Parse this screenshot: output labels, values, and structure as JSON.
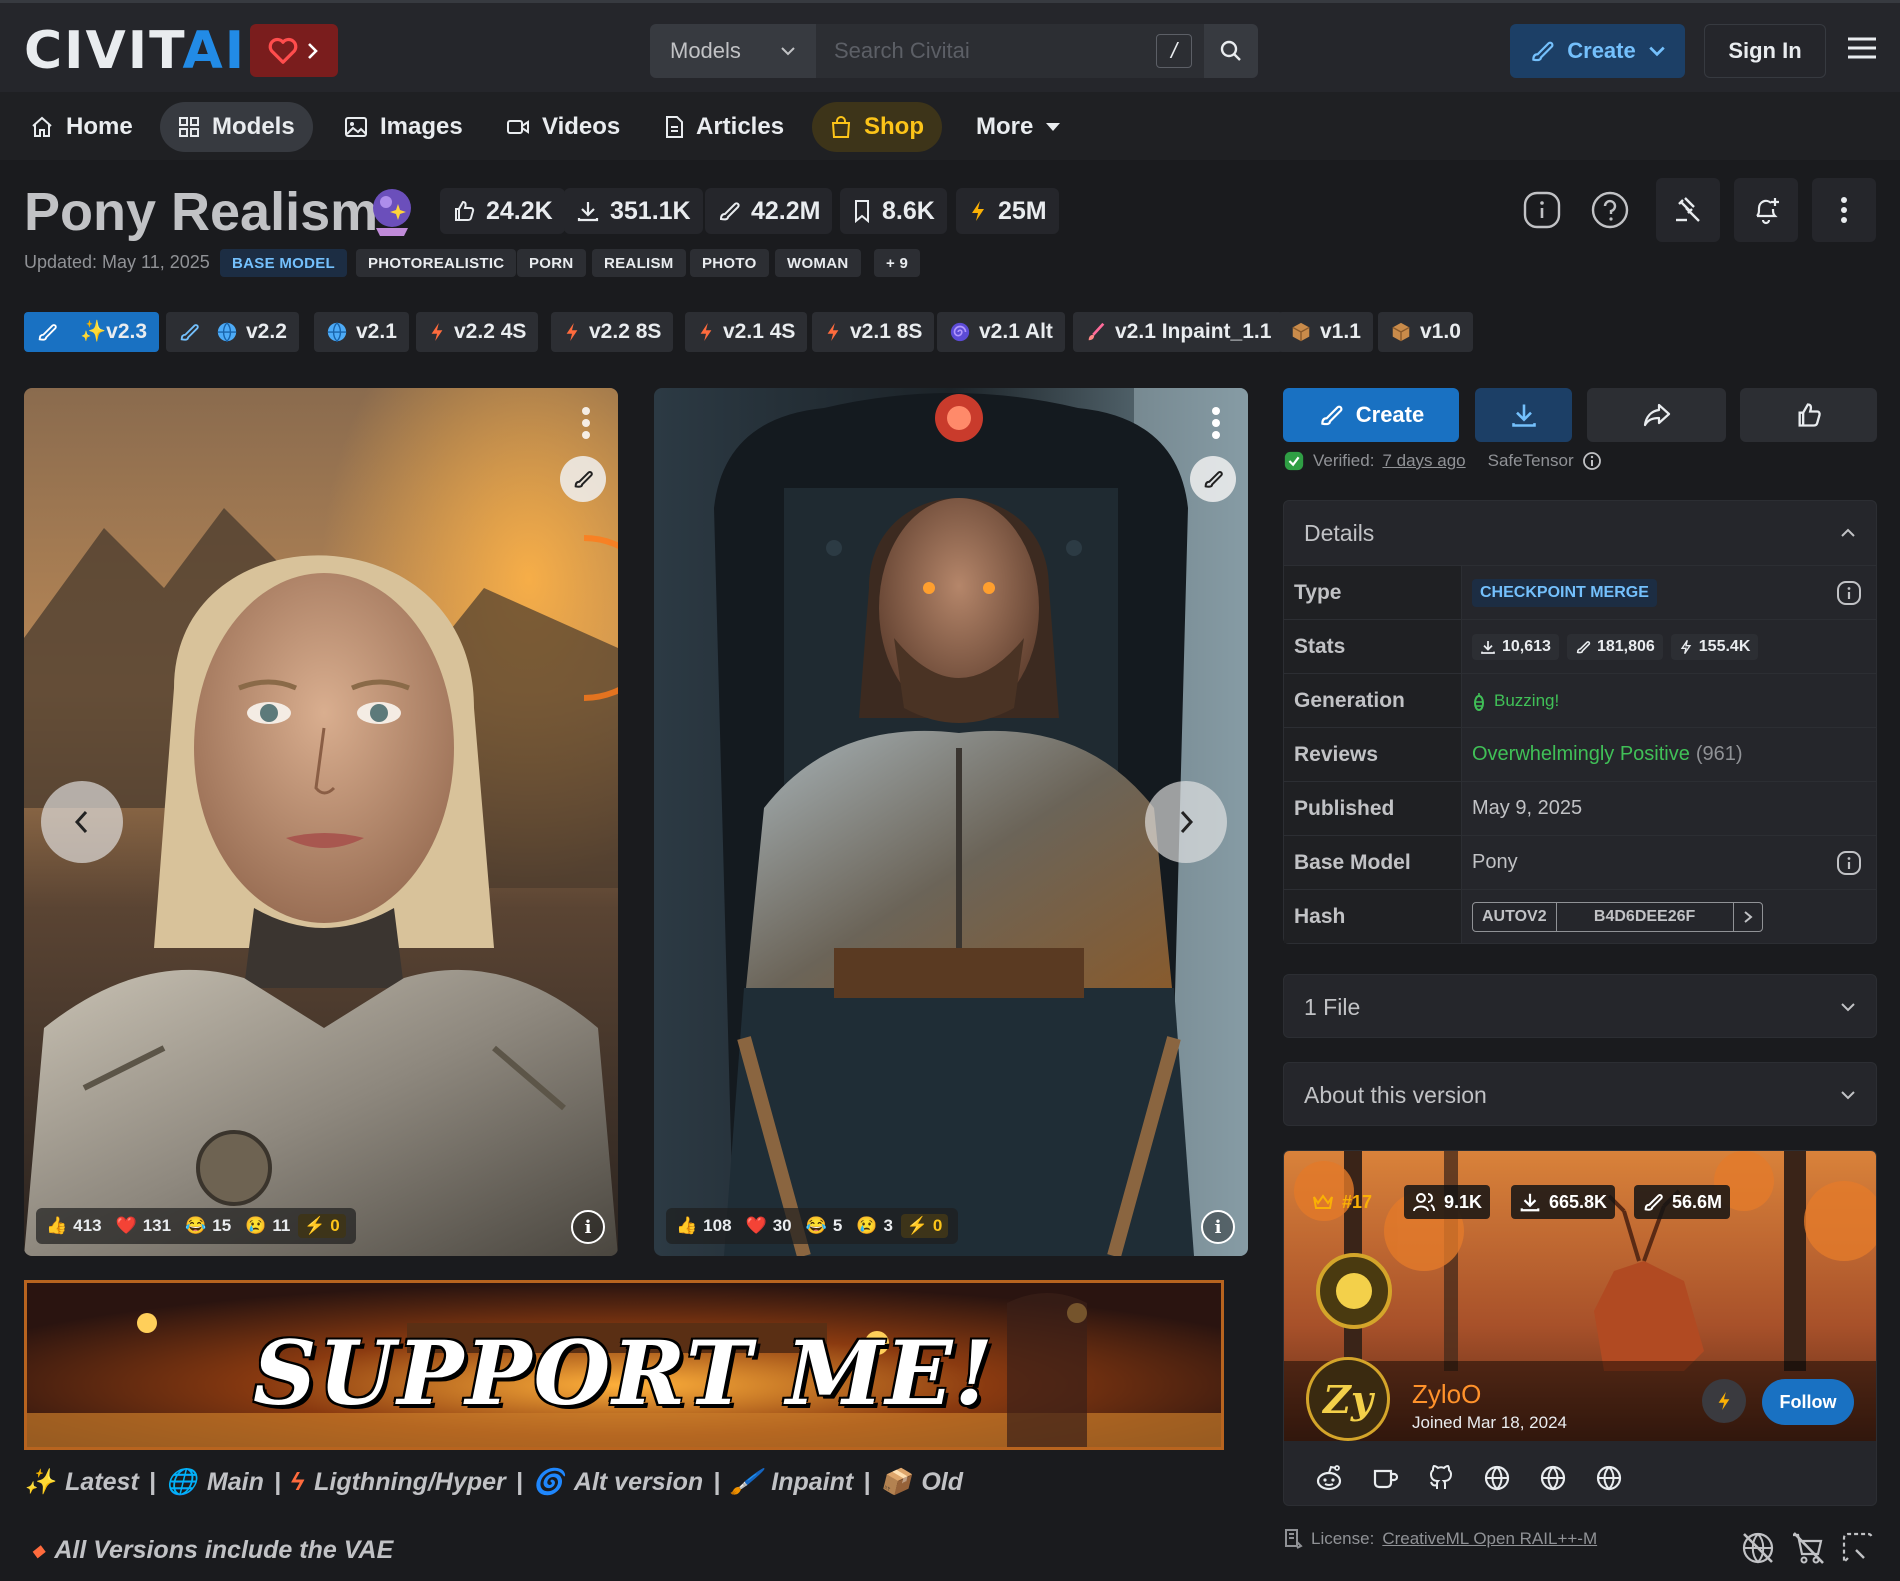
{
  "header": {
    "logo_main": "CIVIT",
    "logo_ai": "AI",
    "search_category": "Models",
    "search_placeholder": "Search Civitai",
    "search_shortcut": "/",
    "create_label": "Create",
    "signin_label": "Sign In"
  },
  "nav": [
    {
      "label": "Home",
      "icon": "home-icon"
    },
    {
      "label": "Models",
      "icon": "models-grid-icon"
    },
    {
      "label": "Images",
      "icon": "image-icon"
    },
    {
      "label": "Videos",
      "icon": "video-icon"
    },
    {
      "label": "Articles",
      "icon": "article-icon"
    },
    {
      "label": "Shop",
      "icon": "shopping-bag-icon"
    },
    {
      "label": "More",
      "icon": "caret-down-icon"
    }
  ],
  "model": {
    "title": "Pony Realism",
    "stats": {
      "likes": "24.2K",
      "downloads": "351.1K",
      "generations": "42.2M",
      "bookmarks": "8.6K",
      "buzz": "25M"
    },
    "updated": "Updated: May 11, 2025",
    "tags": [
      "BASE MODEL",
      "PHOTOREALISTIC",
      "PORN",
      "REALISM",
      "PHOTO",
      "WOMAN",
      "+ 9"
    ]
  },
  "versions": [
    "✨v2.3",
    "v2.2",
    "v2.1",
    "v2.2 4S",
    "v2.2 8S",
    "v2.1 4S",
    "v2.1 8S",
    "v2.1 Alt",
    "v2.1 Inpaint_1.1",
    "v1.1",
    "v1.0"
  ],
  "gallery": [
    {
      "reactions": {
        "like": "413",
        "heart": "131",
        "laugh": "15",
        "cry": "11",
        "buzz": "0"
      }
    },
    {
      "reactions": {
        "like": "108",
        "heart": "30",
        "laugh": "5",
        "cry": "3",
        "buzz": "0"
      }
    }
  ],
  "banner_text": "SUPPORT ME!",
  "description": {
    "line1": [
      {
        "icon": "sparkles",
        "text": "Latest"
      },
      {
        "sep": "|"
      },
      {
        "icon": "globe",
        "text": "Main"
      },
      {
        "sep": "|"
      },
      {
        "icon": "lightning",
        "text": "Ligthning/Hyper"
      },
      {
        "sep": "|"
      },
      {
        "icon": "swirl",
        "text": "Alt version"
      },
      {
        "sep": "|"
      },
      {
        "icon": "brush",
        "text": "Inpaint"
      },
      {
        "sep": "|"
      },
      {
        "icon": "box",
        "text": "Old"
      }
    ],
    "line2": "All Versions include the VAE"
  },
  "actions": {
    "create": "Create"
  },
  "verified": {
    "label": "Verified:",
    "when": "7 days ago",
    "format": "SafeTensor"
  },
  "details": {
    "heading": "Details",
    "type_label": "Type",
    "type_value": "CHECKPOINT MERGE",
    "stats_label": "Stats",
    "stat_downloads": "10,613",
    "stat_generations": "181,806",
    "stat_buzz": "155.4K",
    "generation_label": "Generation",
    "generation_value": "Buzzing!",
    "reviews_label": "Reviews",
    "reviews_value": "Overwhelmingly Positive",
    "reviews_count": "(961)",
    "published_label": "Published",
    "published_value": "May 9, 2025",
    "base_label": "Base Model",
    "base_value": "Pony",
    "hash_label": "Hash",
    "hash_type": "AUTOV2",
    "hash_value": "B4D6DEE26F"
  },
  "files_heading": "1 File",
  "about_heading": "About this version",
  "creator": {
    "rank": "#17",
    "followers": "9.1K",
    "downloads": "665.8K",
    "generations": "56.6M",
    "name": "ZyloO",
    "joined": "Joined Mar 18, 2024",
    "follow": "Follow"
  },
  "license": {
    "label": "License:",
    "value": "CreativeML Open RAIL++-M"
  },
  "colors": {
    "accent": "#228be6",
    "shop": "#fcc419",
    "positive": "#40c057"
  }
}
